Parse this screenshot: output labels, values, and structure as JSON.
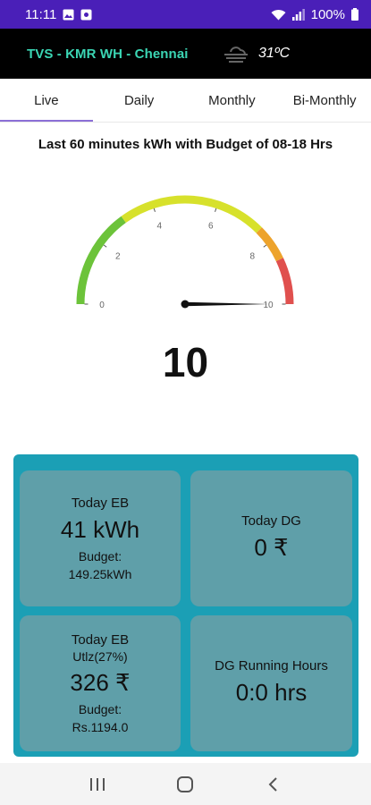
{
  "status_bar": {
    "time": "11:11",
    "battery": "100%",
    "icons": [
      "gallery-icon",
      "app-notification-icon",
      "wifi-icon",
      "signal-icon",
      "battery-icon"
    ]
  },
  "header": {
    "title": "TVS - KMR WH - Chennai",
    "weather_icon": "fog-icon",
    "temperature": "31ºC"
  },
  "tabs": [
    {
      "label": "Live",
      "active": true
    },
    {
      "label": "Daily",
      "active": false
    },
    {
      "label": "Monthly",
      "active": false
    },
    {
      "label": "Bi-Monthly",
      "active": false
    }
  ],
  "live": {
    "heading": "Last 60 minutes kWh with Budget of 08-18 Hrs",
    "gauge": {
      "min": 0,
      "max": 10,
      "value": 10,
      "value_label": "10",
      "ticks": [
        "0",
        "2",
        "4",
        "6",
        "8",
        "10"
      ],
      "bands": [
        {
          "from": 0,
          "to": 3,
          "color": "#6cc33a"
        },
        {
          "from": 3,
          "to": 7.5,
          "color": "#d7e12c"
        },
        {
          "from": 7.5,
          "to": 8.6,
          "color": "#eda32c"
        },
        {
          "from": 8.6,
          "to": 10,
          "color": "#e0504e"
        }
      ]
    }
  },
  "cards": {
    "today_eb": {
      "label": "Today EB",
      "value": "41 kWh",
      "budget_label": "Budget:",
      "budget_value": "149.25kWh"
    },
    "today_dg": {
      "label": "Today DG",
      "value": "0 ₹"
    },
    "today_eb_cost": {
      "label": "Today EB",
      "utilization": "Utlz(27%)",
      "value": "326 ₹",
      "budget_label": "Budget:",
      "budget_value": "Rs.1194.0"
    },
    "dg_hours": {
      "label": "DG Running Hours",
      "value": "0:0 hrs"
    }
  },
  "nav_bar": {
    "buttons": [
      "recent-apps-icon",
      "home-icon",
      "back-icon"
    ]
  }
}
